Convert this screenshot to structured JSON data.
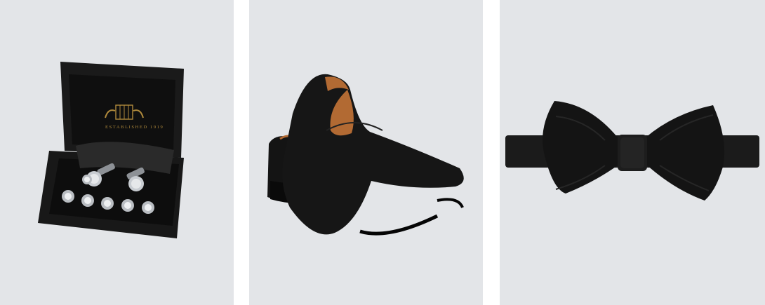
{
  "products": [
    {
      "id_label": "cufflink-stud-set",
      "icon": "gift-box-icon",
      "box_crest_text": "ESTABLISHED 1919",
      "colors": {
        "box": "#161616",
        "lining": "#101010",
        "crest": "#b08a3c",
        "metal": "#9fa3a8"
      }
    },
    {
      "id_label": "velvet-slipper",
      "icon": "loafer-shoe-icon",
      "colors": {
        "velvet": "#121212",
        "lining": "#b26a33",
        "sole": "#0b0b0b"
      }
    },
    {
      "id_label": "bow-tie",
      "icon": "bow-tie-icon",
      "colors": {
        "silk": "#141414",
        "band": "#1b1b1b"
      }
    }
  ],
  "background_color": "#e3e5e8"
}
